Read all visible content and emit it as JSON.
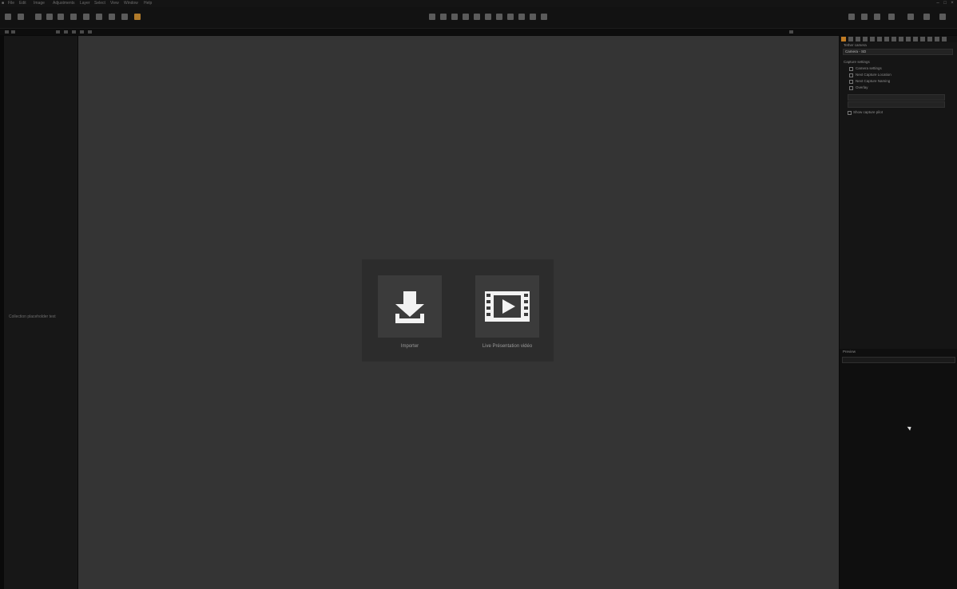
{
  "menubar": {
    "items": [
      "File",
      "Edit",
      "Image",
      "Adjustments",
      "Layer",
      "Select",
      "View",
      "Window",
      "Help"
    ],
    "window_title": "",
    "controls": [
      "–",
      "□",
      "×"
    ]
  },
  "toolbar": {
    "left_icons": [
      "import-icon",
      "library-icon",
      "undo-icon",
      "redo-icon",
      "hand-icon",
      "crop-icon",
      "brush-icon",
      "eraser-icon",
      "gradient-icon",
      "stamp-icon",
      "highlight-icon"
    ],
    "center_icons": [
      "cursor-tool-icon",
      "pan-tool-icon",
      "zoom-tool-icon",
      "crop-tool-icon",
      "straighten-tool-icon",
      "keystone-tool-icon",
      "spot-tool-icon",
      "brush-tool-icon",
      "eraser-tool-icon",
      "gradient-tool-icon",
      "picker-tool-icon"
    ],
    "right_icons": [
      "grid-icon",
      "exposure-icon",
      "proof-icon",
      "compare-icon",
      "copy-icon",
      "apply-icon",
      "reset-icon"
    ]
  },
  "left_panel": {
    "label": "Collection placeholder text"
  },
  "viewer": {
    "welcome": {
      "import_label": "Importer",
      "tutorial_label": "Live Présentation vidéo"
    }
  },
  "right_panel": {
    "header": "Tether camera",
    "selector_value": "Camera - SD",
    "section_title": "Capture settings",
    "options": [
      "Camera settings",
      "Next Capture Location",
      "Next Capture Naming",
      "Overlay"
    ],
    "field1": "",
    "field2": "",
    "check_label": "Show capture pilot",
    "lower_title": "Preview",
    "lower_sub": ""
  },
  "accent_color": "#c07b23"
}
